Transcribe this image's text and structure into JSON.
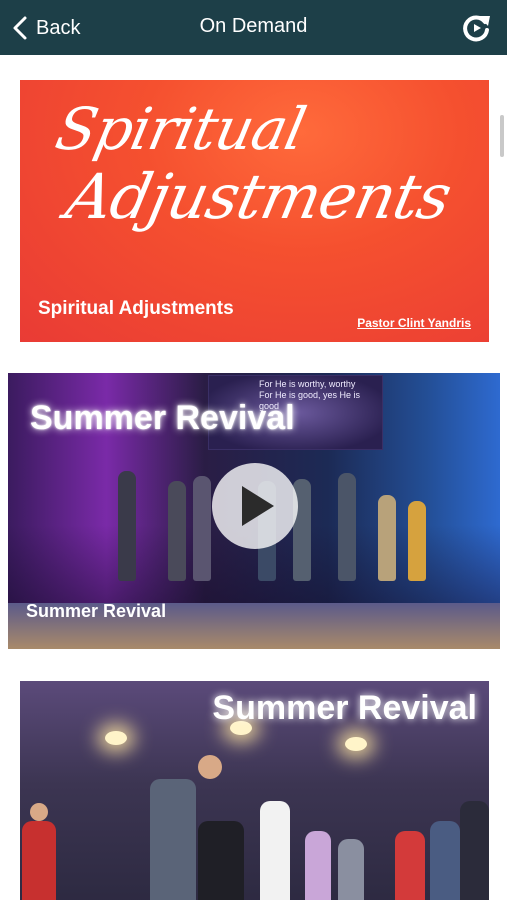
{
  "header": {
    "back_label": "Back",
    "title": "On Demand",
    "back_icon": "chevron-left-icon",
    "refresh_icon": "refresh-icon",
    "bar_color": "#1d3f48"
  },
  "cards": [
    {
      "script_line1": "Spiritual",
      "script_line2": "Adjustments",
      "subtitle": "Spiritual Adjustments",
      "speaker": "Pastor Clint Yandris",
      "accent": "#f5502f"
    },
    {
      "overlay_title": "Summer Revival",
      "bottom_title": "Summer Revival",
      "lyrics": [
        "For He is worthy, worthy",
        "For He is good, yes He is good"
      ],
      "play_icon": "play-icon"
    },
    {
      "overlay_title": "Summer Revival"
    }
  ]
}
